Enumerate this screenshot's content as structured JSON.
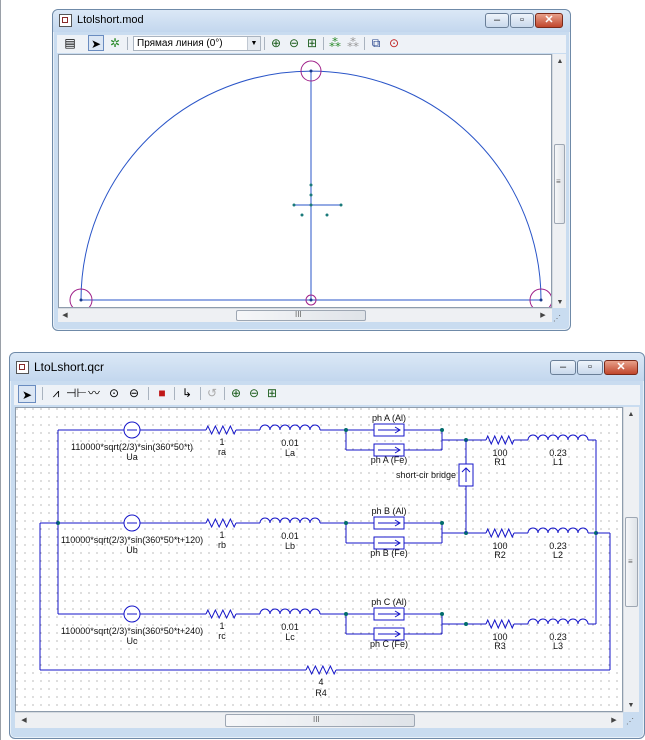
{
  "window1": {
    "title": "Ltolshort.mod",
    "toolbar": {
      "combo_value": "Прямая линия (0°)",
      "tools": [
        "diagram-icon",
        "pointer-icon",
        "magic-wand-icon",
        "zoom-in-icon",
        "zoom-out-icon",
        "fit-icon",
        "snap-points-icon",
        "snap-points-off-icon",
        "copy-icon",
        "stop-icon"
      ]
    },
    "hscroll_grip": "III",
    "vscroll_grip": "≡"
  },
  "window2": {
    "title": "LtoLshort.qcr",
    "toolbar": {
      "tools": [
        "pointer-icon",
        "resistor-icon",
        "capacitor-icon",
        "inductor-icon",
        "voltage-source-icon",
        "current-source-icon",
        "3d-box-icon",
        "wire-icon",
        "undo-icon",
        "zoom-in-icon",
        "zoom-out-icon",
        "fit-icon"
      ]
    },
    "hscroll_grip": "III",
    "vscroll_grip": "≡",
    "circuit": {
      "sources": [
        {
          "expr": "110000*sqrt(2/3)*sin(360*50*t)",
          "name": "Ua"
        },
        {
          "expr": "110000*sqrt(2/3)*sin(360*50*t+120)",
          "name": "Ub"
        },
        {
          "expr": "110000*sqrt(2/3)*sin(360*50*t+240)",
          "name": "Uc"
        }
      ],
      "resistors_r": [
        {
          "value": "1",
          "name": "ra"
        },
        {
          "value": "1",
          "name": "rb"
        },
        {
          "value": "1",
          "name": "rc"
        }
      ],
      "inductors_l": [
        {
          "value": "0.01",
          "name": "La"
        },
        {
          "value": "0.01",
          "name": "Lb"
        },
        {
          "value": "0.01",
          "name": "Lc"
        }
      ],
      "switches": [
        {
          "upper": "ph A (Al)",
          "lower": "ph A (Fe)"
        },
        {
          "upper": "ph B (Al)",
          "lower": "ph B (Fe)"
        },
        {
          "upper": "ph C (Al)",
          "lower": "ph C (Fe)"
        }
      ],
      "load_r": [
        {
          "value": "100",
          "name": "R1"
        },
        {
          "value": "100",
          "name": "R2"
        },
        {
          "value": "100",
          "name": "R3"
        }
      ],
      "load_l": [
        {
          "value": "0.23",
          "name": "L1"
        },
        {
          "value": "0.23",
          "name": "L2"
        },
        {
          "value": "0.23",
          "name": "L3"
        }
      ],
      "bridge_label": "short-cir bridge",
      "r4": {
        "value": "4",
        "name": "R4"
      }
    }
  },
  "colors": {
    "wire": "#1515c8",
    "curve": "#2a55c8",
    "marker": "#a0228a",
    "node": "#006b6b"
  }
}
